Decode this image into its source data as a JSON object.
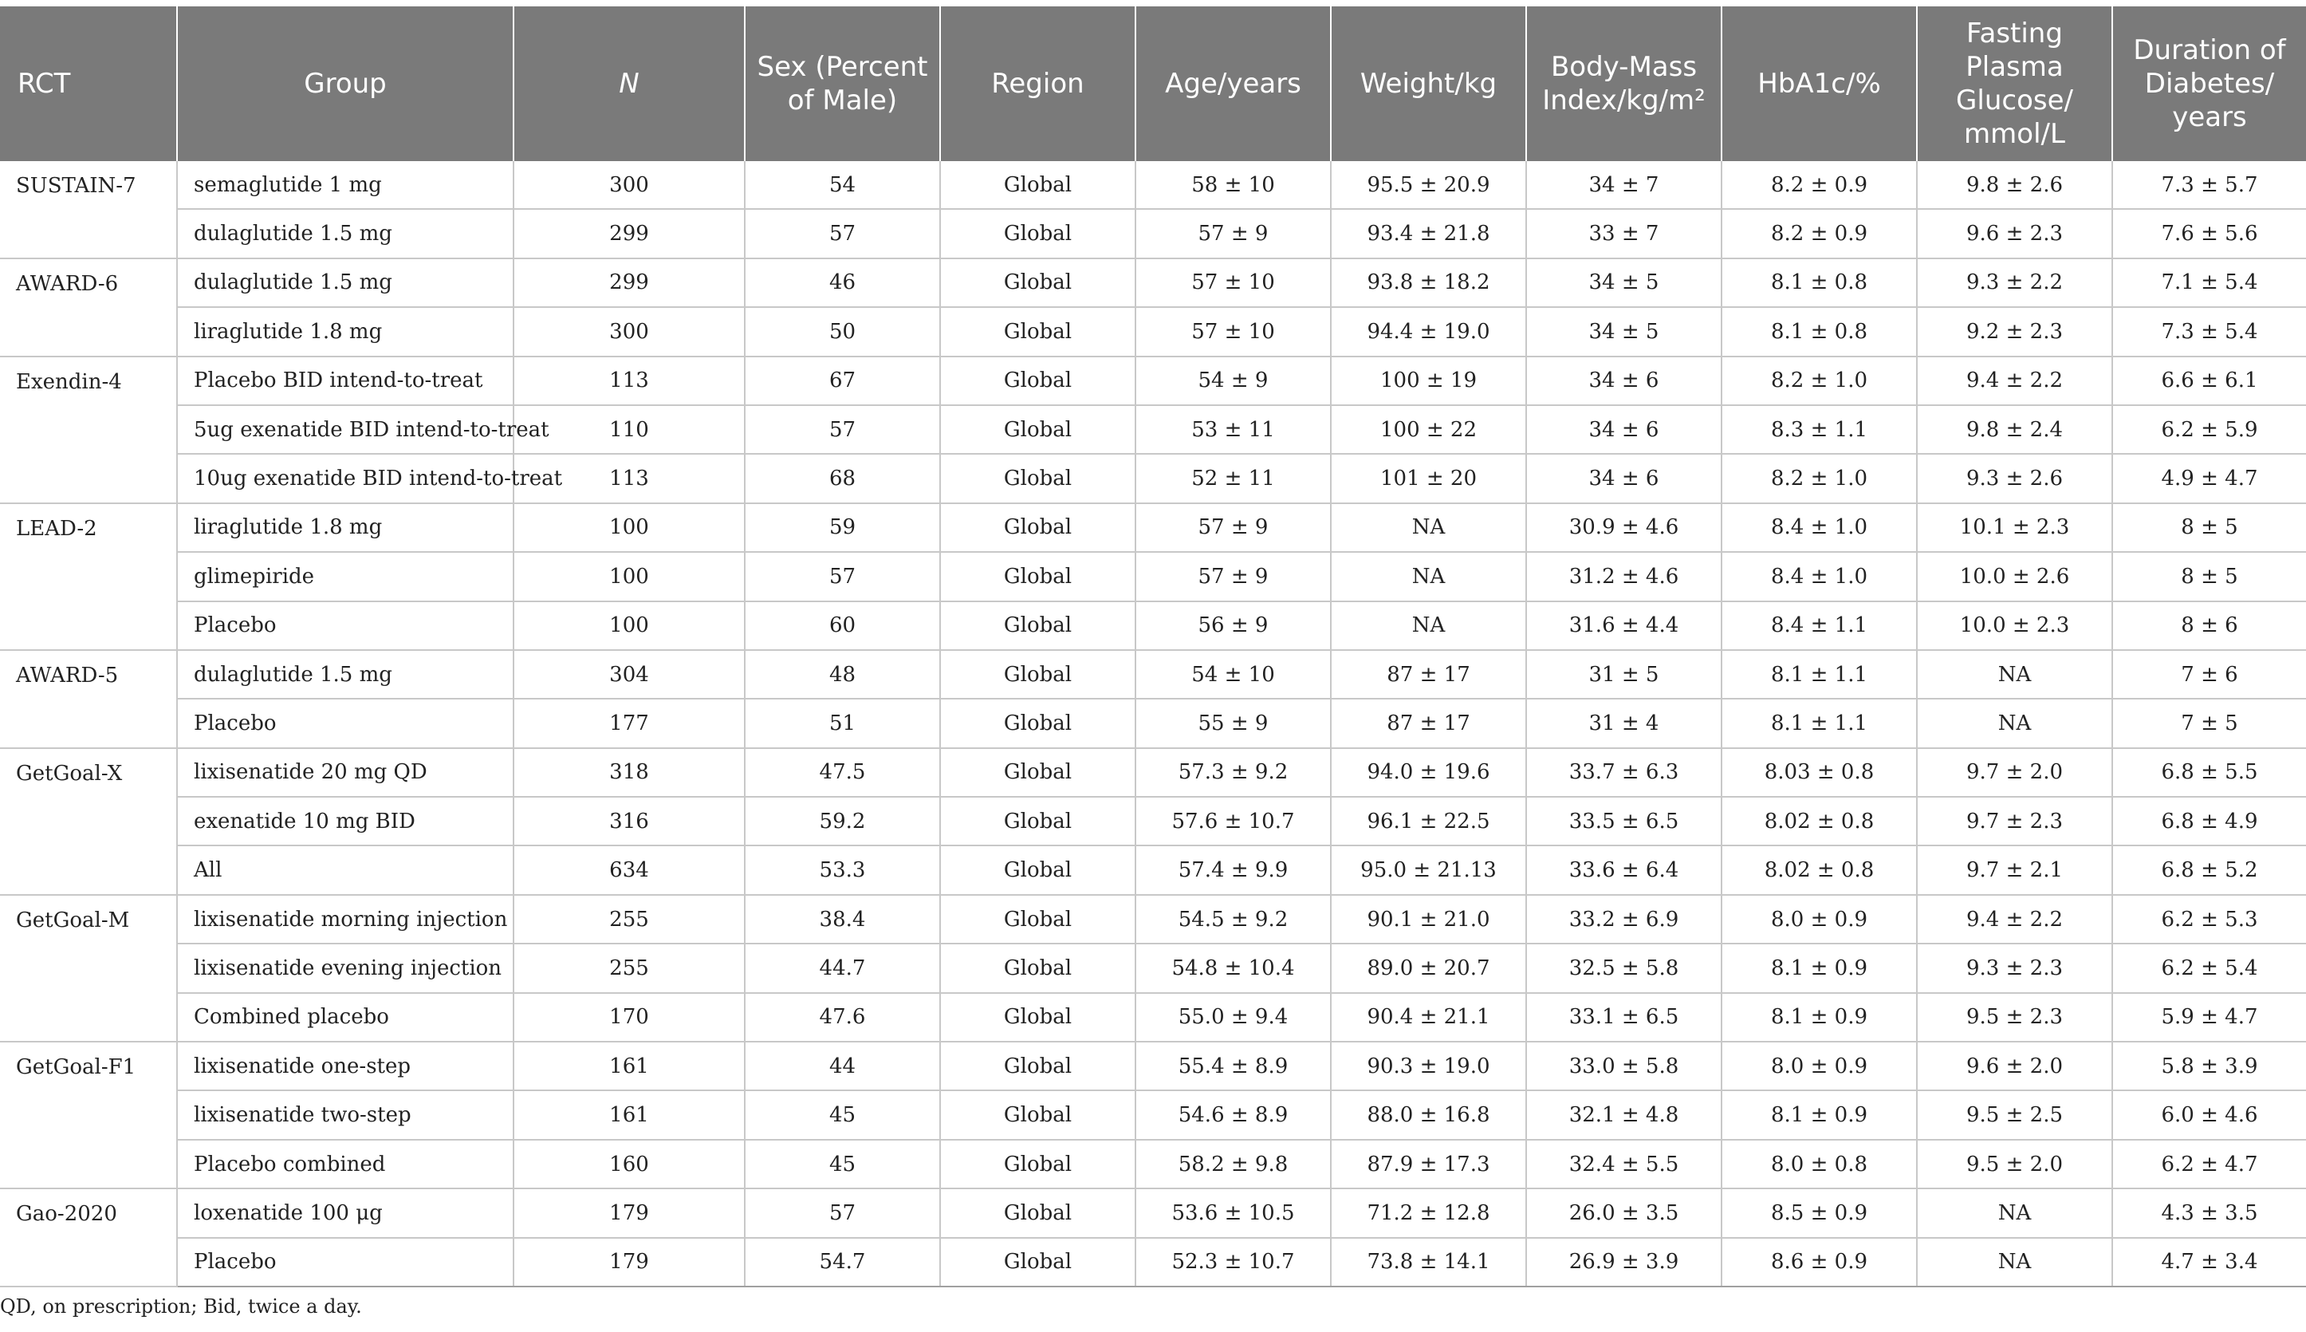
{
  "table": {
    "headers": [
      "RCT",
      "Group",
      "N",
      "Sex (Percent of Male)",
      "Region",
      "Age/years",
      "Weight/kg",
      "Body-Mass Index/kg/m²",
      "HbA1c/%",
      "Fasting Plasma Glucose/ mmol/L",
      "Duration of Diabetes/ years"
    ],
    "trials": [
      {
        "name": "SUSTAIN-7",
        "rows": [
          [
            "semaglutide 1 mg",
            "300",
            "54",
            "Global",
            "58 ± 10",
            "95.5 ± 20.9",
            "34 ± 7",
            "8.2 ± 0.9",
            "9.8 ± 2.6",
            "7.3 ± 5.7"
          ],
          [
            "dulaglutide 1.5 mg",
            "299",
            "57",
            "Global",
            "57 ± 9",
            "93.4 ± 21.8",
            "33 ± 7",
            "8.2 ± 0.9",
            "9.6 ± 2.3",
            "7.6 ± 5.6"
          ]
        ]
      },
      {
        "name": "AWARD-6",
        "rows": [
          [
            "dulaglutide 1.5 mg",
            "299",
            "46",
            "Global",
            "57 ± 10",
            "93.8 ± 18.2",
            "34 ± 5",
            "8.1 ± 0.8",
            "9.3 ± 2.2",
            "7.1 ± 5.4"
          ],
          [
            "liraglutide 1.8 mg",
            "300",
            "50",
            "Global",
            "57 ± 10",
            "94.4 ± 19.0",
            "34 ± 5",
            "8.1 ± 0.8",
            "9.2 ± 2.3",
            "7.3 ± 5.4"
          ]
        ]
      },
      {
        "name": "Exendin-4",
        "rows": [
          [
            "Placebo BID intend-to-treat",
            "113",
            "67",
            "Global",
            "54 ± 9",
            "100 ± 19",
            "34 ± 6",
            "8.2 ± 1.0",
            "9.4 ± 2.2",
            "6.6 ± 6.1"
          ],
          [
            "5ug exenatide BID intend-to-treat",
            "110",
            "57",
            "Global",
            "53 ± 11",
            "100 ± 22",
            "34 ± 6",
            "8.3 ± 1.1",
            "9.8 ± 2.4",
            "6.2 ± 5.9"
          ],
          [
            "10ug exenatide BID intend-to-treat",
            "113",
            "68",
            "Global",
            "52 ± 11",
            "101 ± 20",
            "34 ± 6",
            "8.2 ± 1.0",
            "9.3 ± 2.6",
            "4.9 ± 4.7"
          ]
        ]
      },
      {
        "name": "LEAD-2",
        "rows": [
          [
            "liraglutide 1.8 mg",
            "100",
            "59",
            "Global",
            "57 ± 9",
            "NA",
            "30.9 ± 4.6",
            "8.4 ± 1.0",
            "10.1 ± 2.3",
            "8 ± 5"
          ],
          [
            "glimepiride",
            "100",
            "57",
            "Global",
            "57 ± 9",
            "NA",
            "31.2 ± 4.6",
            "8.4 ± 1.0",
            "10.0 ± 2.6",
            "8 ± 5"
          ],
          [
            "Placebo",
            "100",
            "60",
            "Global",
            "56 ± 9",
            "NA",
            "31.6 ± 4.4",
            "8.4 ± 1.1",
            "10.0 ± 2.3",
            "8 ± 6"
          ]
        ]
      },
      {
        "name": "AWARD-5",
        "rows": [
          [
            "dulaglutide 1.5 mg",
            "304",
            "48",
            "Global",
            "54 ± 10",
            "87 ± 17",
            "31 ± 5",
            "8.1 ± 1.1",
            "NA",
            "7 ± 6"
          ],
          [
            "Placebo",
            "177",
            "51",
            "Global",
            "55 ± 9",
            "87 ± 17",
            "31 ± 4",
            "8.1 ± 1.1",
            "NA",
            "7 ± 5"
          ]
        ]
      },
      {
        "name": "GetGoal-X",
        "rows": [
          [
            "lixisenatide 20 mg QD",
            "318",
            "47.5",
            "Global",
            "57.3 ± 9.2",
            "94.0 ± 19.6",
            "33.7 ± 6.3",
            "8.03 ± 0.8",
            "9.7 ± 2.0",
            "6.8 ± 5.5"
          ],
          [
            "exenatide 10 mg BID",
            "316",
            "59.2",
            "Global",
            "57.6 ± 10.7",
            "96.1 ± 22.5",
            "33.5 ± 6.5",
            "8.02 ± 0.8",
            "9.7 ± 2.3",
            "6.8 ± 4.9"
          ],
          [
            "All",
            "634",
            "53.3",
            "Global",
            "57.4 ± 9.9",
            "95.0 ± 21.13",
            "33.6 ± 6.4",
            "8.02 ± 0.8",
            "9.7 ± 2.1",
            "6.8 ± 5.2"
          ]
        ]
      },
      {
        "name": "GetGoal-M",
        "rows": [
          [
            "lixisenatide morning injection",
            "255",
            "38.4",
            "Global",
            "54.5 ± 9.2",
            "90.1 ± 21.0",
            "33.2 ± 6.9",
            "8.0 ± 0.9",
            "9.4 ± 2.2",
            "6.2 ± 5.3"
          ],
          [
            "lixisenatide evening injection",
            "255",
            "44.7",
            "Global",
            "54.8 ± 10.4",
            "89.0 ± 20.7",
            "32.5 ± 5.8",
            "8.1 ± 0.9",
            "9.3 ± 2.3",
            "6.2 ± 5.4"
          ],
          [
            "Combined placebo",
            "170",
            "47.6",
            "Global",
            "55.0 ± 9.4",
            "90.4 ± 21.1",
            "33.1 ± 6.5",
            "8.1 ± 0.9",
            "9.5 ± 2.3",
            "5.9 ± 4.7"
          ]
        ]
      },
      {
        "name": "GetGoal-F1",
        "rows": [
          [
            "lixisenatide one-step",
            "161",
            "44",
            "Global",
            "55.4 ± 8.9",
            "90.3 ± 19.0",
            "33.0 ± 5.8",
            "8.0 ± 0.9",
            "9.6 ± 2.0",
            "5.8 ± 3.9"
          ],
          [
            "lixisenatide two-step",
            "161",
            "45",
            "Global",
            "54.6 ± 8.9",
            "88.0 ± 16.8",
            "32.1 ± 4.8",
            "8.1 ± 0.9",
            "9.5 ± 2.5",
            "6.0 ± 4.6"
          ],
          [
            "Placebo combined",
            "160",
            "45",
            "Global",
            "58.2 ± 9.8",
            "87.9 ± 17.3",
            "32.4 ± 5.5",
            "8.0 ± 0.8",
            "9.5 ± 2.0",
            "6.2 ± 4.7"
          ]
        ]
      },
      {
        "name": "Gao-2020",
        "rows": [
          [
            "loxenatide 100 μg",
            "179",
            "57",
            "Global",
            "53.6 ± 10.5",
            "71.2 ± 12.8",
            "26.0 ± 3.5",
            "8.5 ± 0.9",
            "NA",
            "4.3 ± 3.5"
          ],
          [
            "Placebo",
            "179",
            "54.7",
            "Global",
            "52.3 ± 10.7",
            "73.8 ± 14.1",
            "26.9 ± 3.9",
            "8.6 ± 0.9",
            "NA",
            "4.7 ± 3.4"
          ]
        ]
      }
    ]
  },
  "footnote": "QD, on prescription; Bid, twice a day."
}
